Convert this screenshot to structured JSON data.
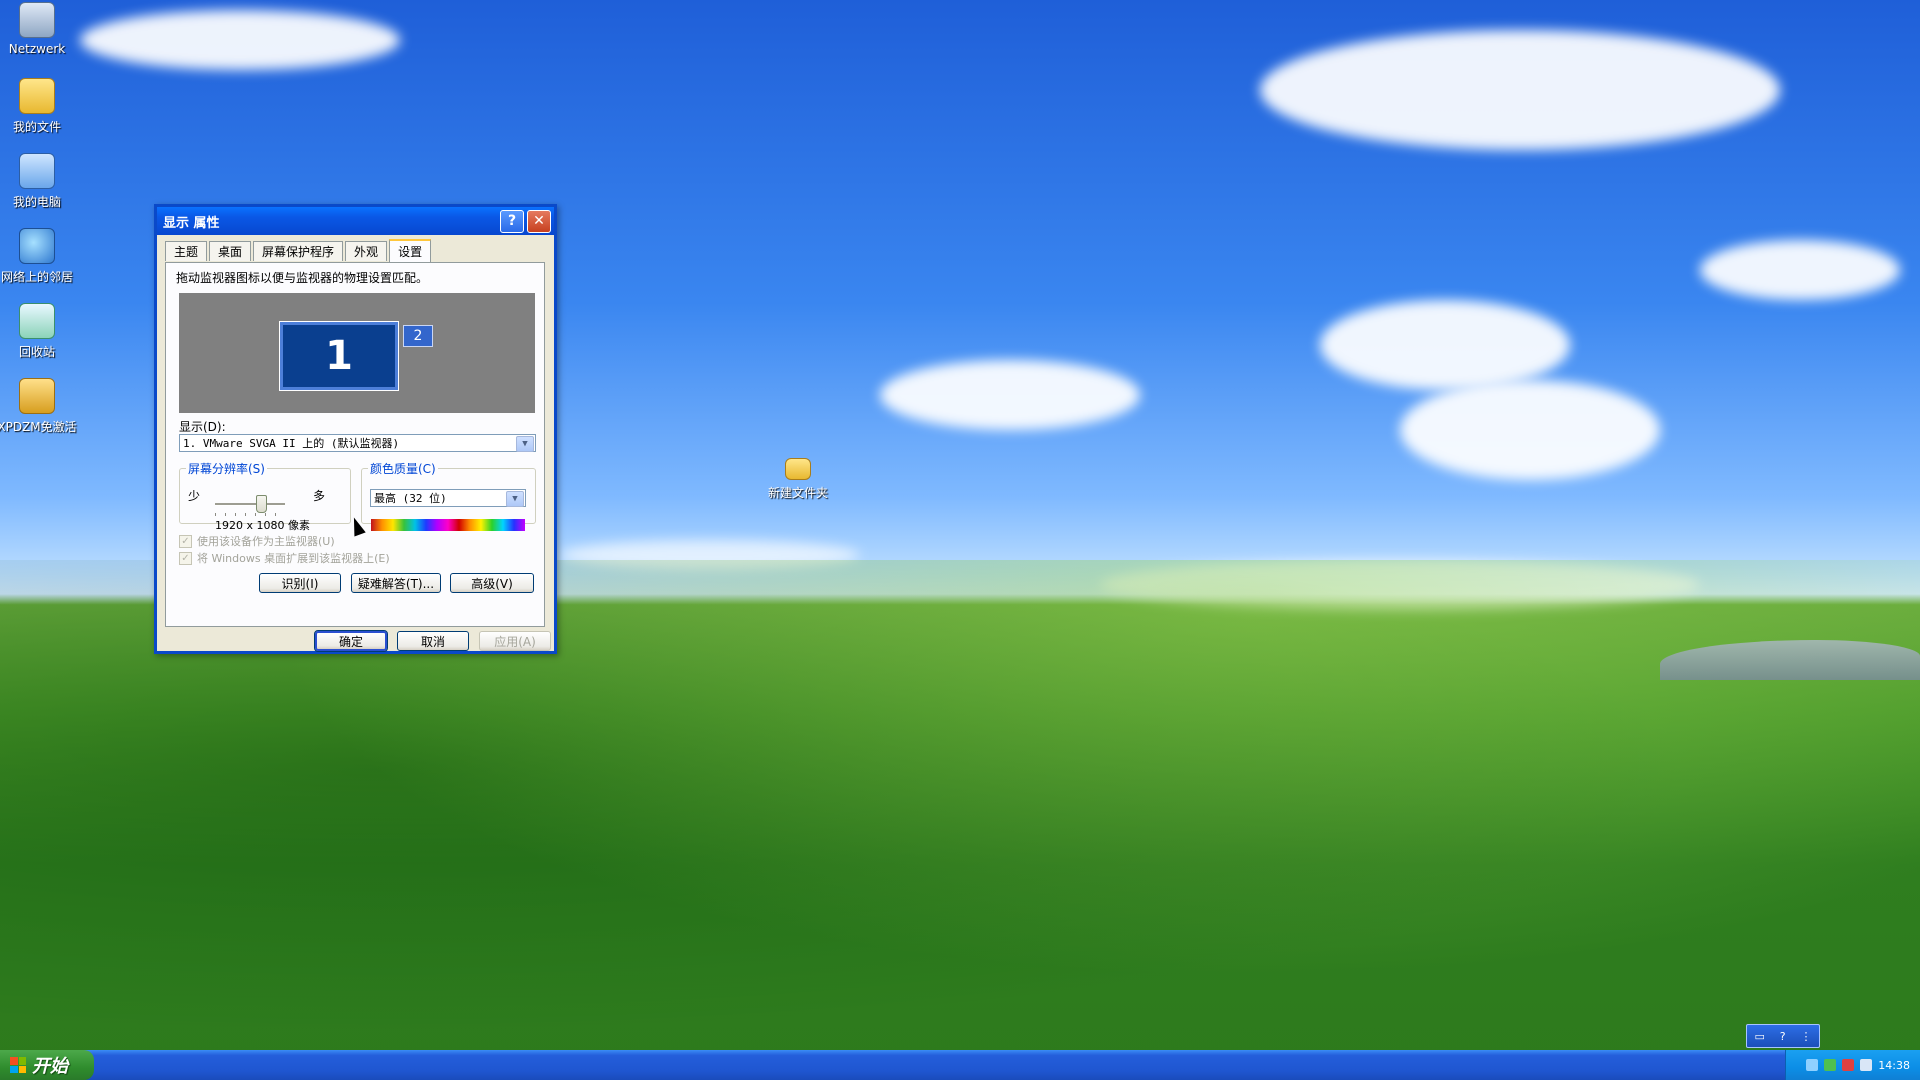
{
  "desktop": {
    "icons": [
      {
        "label": "Netzwerk"
      },
      {
        "label": "我的文件"
      },
      {
        "label": "我的电脑"
      },
      {
        "label": "网络上的邻居"
      },
      {
        "label": "回收站"
      },
      {
        "label": "XPDZM免激活"
      },
      {
        "label": "新建文件夹"
      }
    ]
  },
  "dialog": {
    "title": "显示 属性",
    "title_help": "?",
    "title_close": "✕",
    "tabs": [
      "主题",
      "桌面",
      "屏幕保护程序",
      "外观",
      "设置"
    ],
    "active_tab": "设置",
    "hint": "拖动监视器图标以便与监视器的物理设置匹配。",
    "monitor_1": "1",
    "monitor_2": "2",
    "display_label": "显示(D):",
    "display_value": "1. VMware SVGA II 上的 (默认监视器)",
    "resolution": {
      "legend": "屏幕分辨率(S)",
      "less": "少",
      "more": "多",
      "value_text": "1920 x 1080 像素"
    },
    "color_quality": {
      "legend": "颜色质量(C)",
      "value": "最高 (32 位)"
    },
    "checkbox_primary": "使用该设备作为主监视器(U)",
    "checkbox_extend": "将 Windows 桌面扩展到该监视器上(E)",
    "buttons": {
      "identify": "识别(I)",
      "troubleshoot": "疑难解答(T)...",
      "advanced": "高级(V)",
      "ok": "确定",
      "cancel": "取消",
      "apply": "应用(A)"
    }
  },
  "taskbar": {
    "start_label": "开始",
    "clock": "14:38"
  },
  "colors": {
    "title_blue": "#0a58e6",
    "legend_blue": "#0046d5",
    "start_green": "#2f8c2d"
  }
}
